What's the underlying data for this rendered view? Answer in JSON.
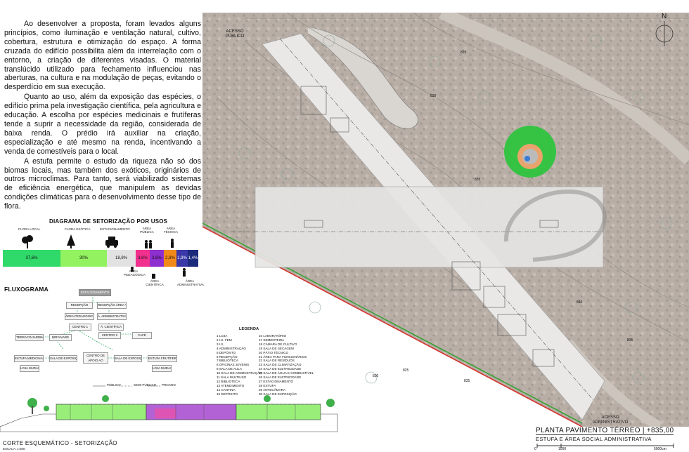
{
  "text": {
    "paragraphs": [
      "Ao desenvolver a proposta, foram levados alguns princípios, como iluminação e ventilação natural, cultivo, cobertura, estrutura e otimização do espaço. A forma cruzada do edifício possibilita além da interrelação com o entorno, a criação de diferentes visadas. O material translúcido utilizado para fechamento influenciou nas aberturas, na cultura e na modulação de peças, evitando o desperdício em sua execução.",
      "Quanto ao uso, além da exposição das espécies, o edifício prima pela investigação científica, pela agricultura e educação. A escolha por espécies medicinais e frutíferas tende a suprir a necessidade da região, considerada de baixa renda. O prédio irá auxiliar na criação, especialização e até mesmo na renda, incentivando a venda de comestíveis para o local.",
      "A estufa permite o estudo da riqueza não só dos biomas locais, mas também dos exóticos, originários de outros microclimas. Para tanto, será viabilizado sistemas de eficiência energética, que manipulem as devidas condições climáticas para o desenvolvimento desse tipo de flora."
    ]
  },
  "usage_diagram": {
    "title": "DIAGRAMA DE SETORIZAÇÃO POR USOS",
    "segments": [
      {
        "label_top": "FLORA LOCAL",
        "value": "37,6%",
        "color": "#2fd96a"
      },
      {
        "label_top": "FLORA EXÓTICA",
        "value": "30%",
        "color": "#93f25f"
      },
      {
        "label_top": "ESTACIONAMENTO",
        "value": "18,8%",
        "color": "#e2e2e2"
      },
      {
        "label_top": "",
        "label_bottom": "ÁREA PEDAGÓGICA",
        "value": "3,8%",
        "color": "#f2318f"
      },
      {
        "label_top": "ÁREA PÚBLICA",
        "value": "3,6%",
        "color": "#8e2fcf"
      },
      {
        "label_top": "",
        "label_bottom": "ÁREA CIENTÍFICA",
        "value": "2,9%",
        "color": "#f28a1a"
      },
      {
        "label_top": "ÁREA TÉCNICA",
        "value": "1,9%",
        "color": "#3a38a8"
      },
      {
        "label_top": "",
        "label_bottom": "ÁREA ADMINISTRATIVA",
        "value": "1,4%",
        "color": "#1c2a7c"
      }
    ]
  },
  "flux": {
    "title": "FLUXOGRAMA",
    "boxes": [
      "ESTACIONAMENTO",
      "RECEPÇÃO",
      "RECEPÇÃO ÁREA TÉCNICA",
      "ÁREA PEDAGÓGICA",
      "Á. ADMINISTRATIVA",
      "CENTRO 1",
      "Á. CIENTÍFICA",
      "CENTRO 2",
      "CAFÉ",
      "TERRACO/JARDIM",
      "BIRYAVARE",
      "ESTUFA MEDICINAL",
      "SALA DE EXPOSIÇÃO",
      "CENTRO DE APOIO AO VISITANTE",
      "SALA DE EXPOSIÇÃO",
      "ESTUFA FRUTÍFERA",
      "LOJA MUDAS",
      "LOJA MUDAS"
    ],
    "legend": [
      "PÚBLICO",
      "SEMI-PÚBLICO",
      "PRIVADO"
    ]
  },
  "legend": {
    "title": "LEGENDA",
    "col1": [
      "1 LOJA",
      "2 I.S. FEM",
      "3 I.S.",
      "4 ADMINISTRAÇÃO",
      "5 DEPÓSITO",
      "6 RECEPÇÃO",
      "7 BIBLIOTECA",
      "8 OFICINAS JUVENIS",
      "9 SALA DE AULA",
      "10 SALA DE ADMINISTRAÇÃO",
      "11 SALA MULTIUSO",
      "12 BIBLIOTECA",
      "13 ATENDIMENTO",
      "14 CANTINA",
      "15 DEPÓSITO"
    ],
    "col2": [
      "16 LABORATÓRIO",
      "17 SEMENTEIRA",
      "18 CÂMARA DE CULTIVO",
      "19 SALA DE SECAGEM",
      "20 PÁTIO TÉCNICO",
      "21 ÁREA PARA FUNCIONÁRIOS",
      "22 SALA DE RESÍDUOS",
      "23 SALA DE CLIMATIZAÇÃO",
      "24 SALA DE ELETRICIDADE",
      "25 SALA DE ÁGUA E COMBUSTÍVEL",
      "26 SALA DE ELETRICIDADE",
      "27 ESTACIONAMENTO",
      "28 ESTUFA",
      "29 ANTECÂMARA",
      "30 SALA DE EXPOSIÇÃO"
    ]
  },
  "section": {
    "title": "CORTE ESQUEMÁTICO - SETORIZAÇÃO",
    "scale": "ESCALA: 1:500"
  },
  "plan": {
    "labels": {
      "public_access": "ACESSO PÚBLICO",
      "admin_access": "ACESSO ADMINISTRATIVO",
      "north": "N",
      "contours": [
        "825",
        "830",
        "835",
        "840",
        "835",
        "825",
        "830",
        "835"
      ]
    },
    "title": "PLANTA PAVIMENTO TÉRREO | +835,00",
    "subtitle": "ESTUFA E ÁREA SOCIAL ADMINISTRATIVA",
    "scalebar": [
      "0",
      "1000",
      "5000cm"
    ]
  },
  "colors": {
    "terrain": "#b5aaa2",
    "building": "#e9e8e6",
    "tree_green": "#2ac43c",
    "border_green": "#3aa336",
    "border_red": "#d2322d"
  }
}
